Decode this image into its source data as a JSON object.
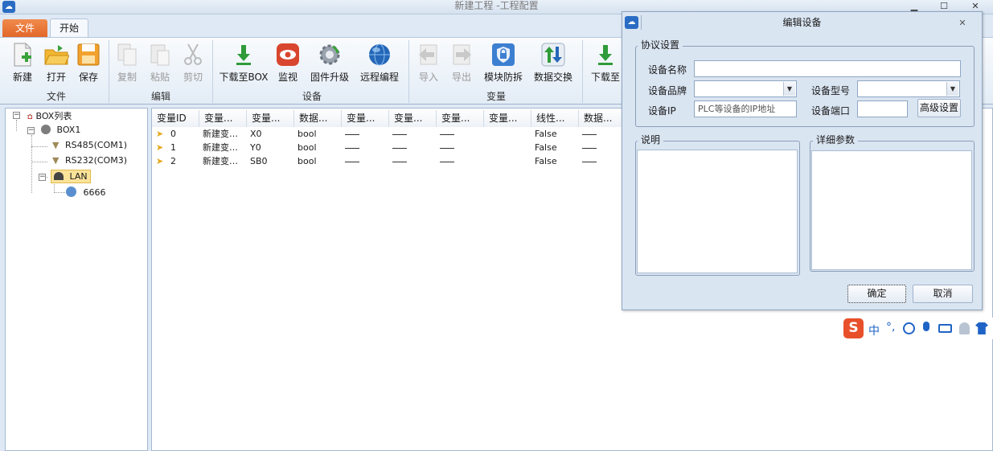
{
  "window": {
    "title": "新建工程 -工程配置"
  },
  "tabs": {
    "file": "文件",
    "start": "开始"
  },
  "ribbon": {
    "file_group": {
      "label": "文件",
      "new": "新建",
      "open": "打开",
      "save": "保存"
    },
    "edit_group": {
      "label": "编辑",
      "copy": "复制",
      "paste": "粘贴",
      "cut": "剪切"
    },
    "device_group": {
      "label": "设备",
      "download_box": "下载至BOX",
      "monitor": "监视",
      "firmware": "固件升级",
      "remote": "远程编程"
    },
    "variable_group": {
      "label": "变量",
      "import": "导入",
      "export": "导出",
      "anti_removal": "模块防拆",
      "data_exchange": "数据交换",
      "download": "下载至"
    }
  },
  "tree": {
    "root": "BOX列表",
    "box": "BOX1",
    "com1": "RS485(COM1)",
    "com2": "RS232(COM3)",
    "lan": "LAN",
    "device": "6666"
  },
  "grid": {
    "columns": [
      "变量ID",
      "变量...",
      "变量...",
      "数据...",
      "变量...",
      "变量...",
      "变量...",
      "变量...",
      "线性...",
      "数据..."
    ],
    "rows": [
      {
        "id": "0",
        "name": "新建变…",
        "addr": "X0",
        "type": "bool",
        "linear": "False"
      },
      {
        "id": "1",
        "name": "新建变…",
        "addr": "Y0",
        "type": "bool",
        "linear": "False"
      },
      {
        "id": "2",
        "name": "新建变…",
        "addr": "SB0",
        "type": "bool",
        "linear": "False"
      }
    ]
  },
  "dialog": {
    "title": "编辑设备",
    "protocol_group": "协议设置",
    "device_name_label": "设备名称",
    "device_name_value": "",
    "brand_label": "设备品牌",
    "brand_value": "",
    "model_label": "设备型号",
    "model_value": "",
    "ip_label": "设备IP",
    "ip_placeholder": "PLC等设备的IP地址",
    "port_label": "设备端口",
    "port_value": "",
    "advanced_button": "高级设置",
    "desc_group": "说明",
    "detail_group": "详细参数",
    "ok_button": "确定",
    "cancel_button": "取消"
  },
  "ime": {
    "mode": "中",
    "punct": "°,"
  },
  "colors": {
    "accent_orange": "#e2672a",
    "ribbon_bg": "#e3ecf6",
    "dialog_bg": "#dae5f2"
  }
}
